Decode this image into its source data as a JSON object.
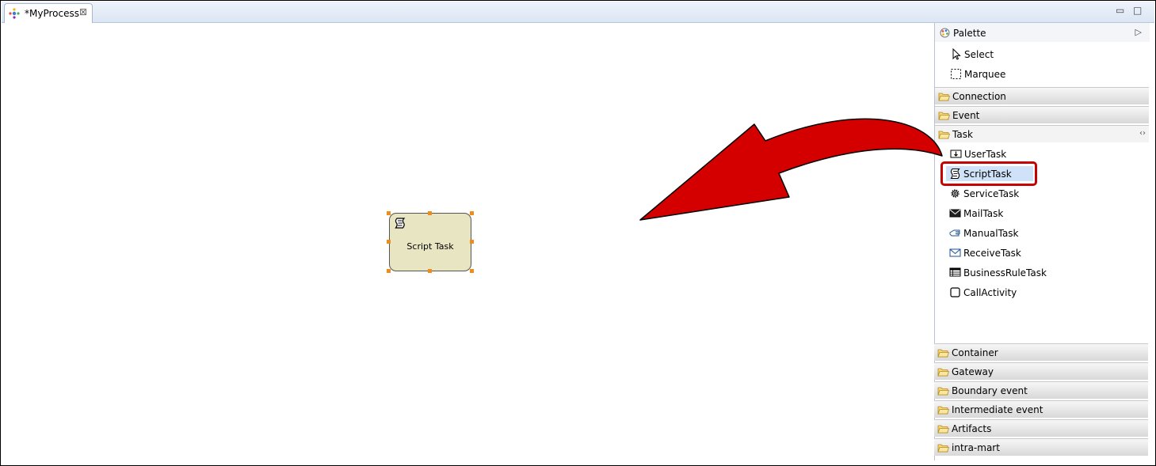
{
  "editor_tab": {
    "title": "*MyProcess",
    "close_symbol": "⊠"
  },
  "window_controls": {
    "minimize": "▭",
    "maximize": "□"
  },
  "canvas": {
    "script_task": {
      "label": "Script Task"
    }
  },
  "palette": {
    "title": "Palette",
    "collapse_symbol": "▷",
    "tools": [
      {
        "label": "Select",
        "icon": "arrow-cursor-icon"
      },
      {
        "label": "Marquee",
        "icon": "marquee-icon"
      }
    ],
    "drawers_before": [
      {
        "label": "Connection"
      },
      {
        "label": "Event"
      }
    ],
    "task_drawer": {
      "label": "Task",
      "pin_symbol": "‹›",
      "items": [
        {
          "label": "UserTask",
          "icon": "user-task-icon"
        },
        {
          "label": "ScriptTask",
          "icon": "script-icon"
        },
        {
          "label": "ServiceTask",
          "icon": "gear-icon"
        },
        {
          "label": "MailTask",
          "icon": "mail-icon"
        },
        {
          "label": "ManualTask",
          "icon": "hand-icon"
        },
        {
          "label": "ReceiveTask",
          "icon": "envelope-icon"
        },
        {
          "label": "BusinessRuleTask",
          "icon": "table-icon"
        },
        {
          "label": "CallActivity",
          "icon": "call-activity-icon"
        }
      ]
    },
    "drawers_after": [
      {
        "label": "Container"
      },
      {
        "label": "Gateway"
      },
      {
        "label": "Boundary event"
      },
      {
        "label": "Intermediate event"
      },
      {
        "label": "Artifacts"
      },
      {
        "label": "intra-mart"
      }
    ]
  },
  "colors": {
    "annotation_red": "#d40000",
    "task_fill": "#e8e5c2",
    "selection_handle": "#f08c1a",
    "selected_item_bg": "#cfe2f8"
  }
}
